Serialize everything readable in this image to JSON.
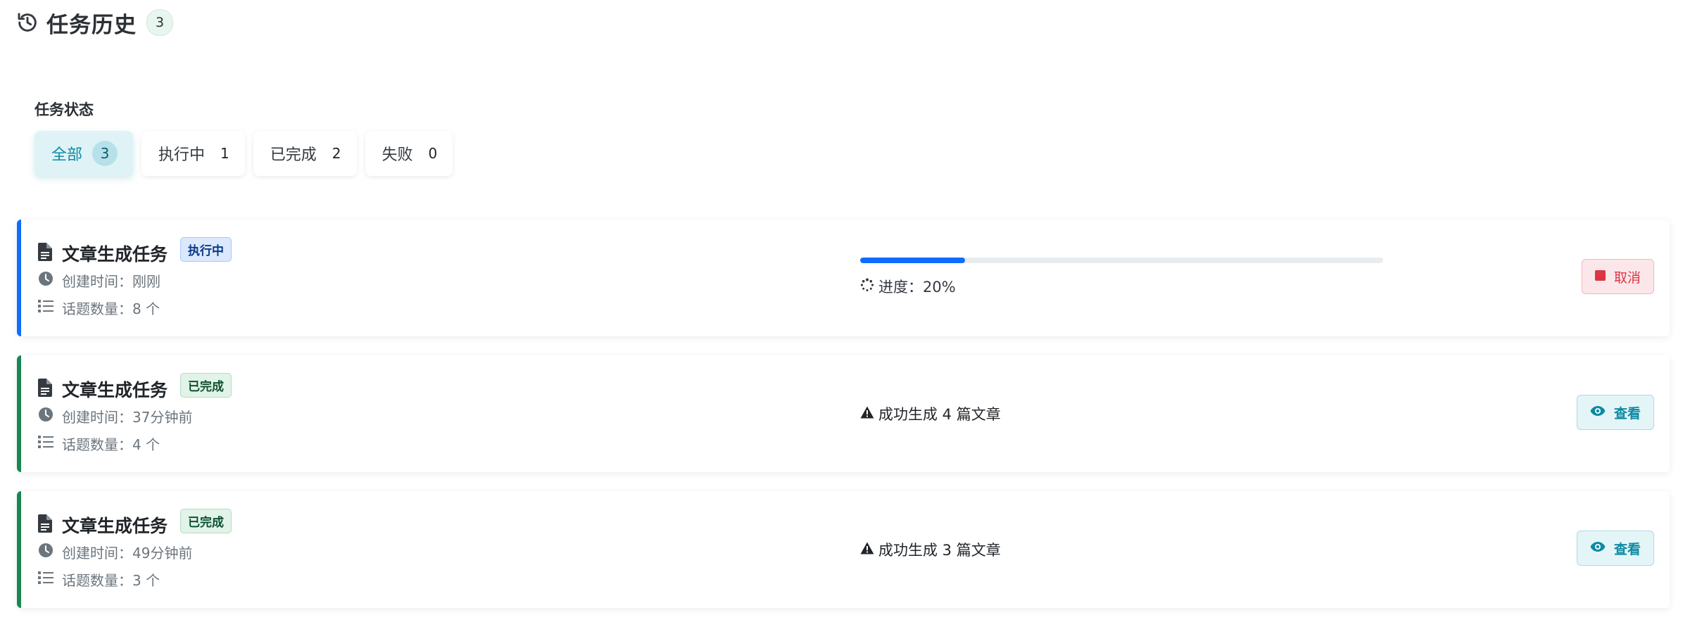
{
  "header": {
    "title": "任务历史",
    "count": "3",
    "icon": "history-icon"
  },
  "filters": {
    "label": "任务状态",
    "items": [
      {
        "label": "全部",
        "count": "3",
        "active": true
      },
      {
        "label": "执行中",
        "count": "1"
      },
      {
        "label": "已完成",
        "count": "2"
      },
      {
        "label": "失败",
        "count": "0"
      }
    ]
  },
  "colors": {
    "running": "#0d6efd",
    "completed": "#198754",
    "cancel": "#dc3545",
    "accent": "#0e8aa3"
  },
  "tasks": [
    {
      "title": "文章生成任务",
      "status": "执行中",
      "created": "创建时间：刚刚",
      "topics": "话题数量：8 个",
      "progress_value": 0.2,
      "progress_text": "进度：20%",
      "action": "取消"
    },
    {
      "title": "文章生成任务",
      "status": "已完成",
      "created": "创建时间：37分钟前",
      "topics": "话题数量：4 个",
      "result": "成功生成 4 篇文章",
      "action": "查看"
    },
    {
      "title": "文章生成任务",
      "status": "已完成",
      "created": "创建时间：49分钟前",
      "topics": "话题数量：3 个",
      "result": "成功生成 3 篇文章",
      "action": "查看"
    }
  ]
}
